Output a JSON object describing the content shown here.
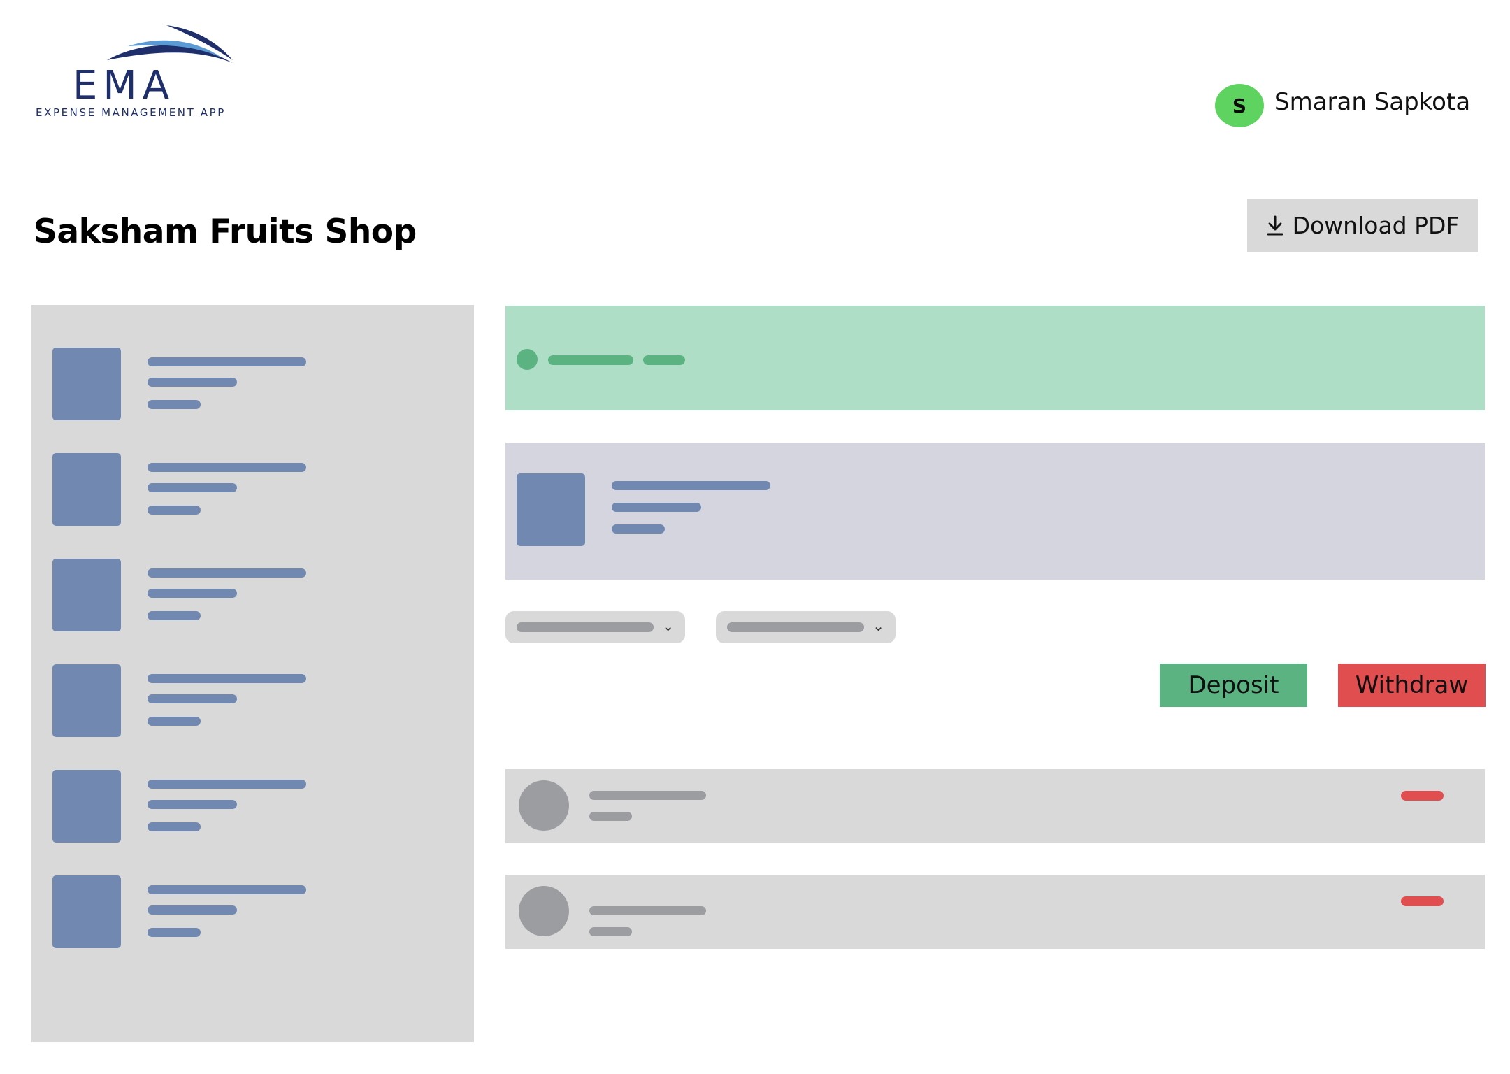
{
  "app": {
    "logo_text": "EMA",
    "logo_tagline": "EXPENSE MANAGEMENT APP"
  },
  "user": {
    "initial": "S",
    "name": "Smaran Sapkota",
    "avatar_color": "#5fd35f"
  },
  "page": {
    "title": "Saksham Fruits Shop"
  },
  "toolbar": {
    "download_label": "Download PDF",
    "download_icon": "download-icon"
  },
  "actions": {
    "deposit_label": "Deposit",
    "withdraw_label": "Withdraw",
    "deposit_color": "#5bb382",
    "withdraw_color": "#e04e50"
  },
  "filters": [
    {
      "icon": "chevron-down-icon"
    },
    {
      "icon": "chevron-down-icon"
    }
  ],
  "colors": {
    "placeholder_blue": "#7189b0",
    "summary_green": "#aedfc6",
    "account_card": "#d5d5e0",
    "panel_gray": "#d9d9d9"
  }
}
